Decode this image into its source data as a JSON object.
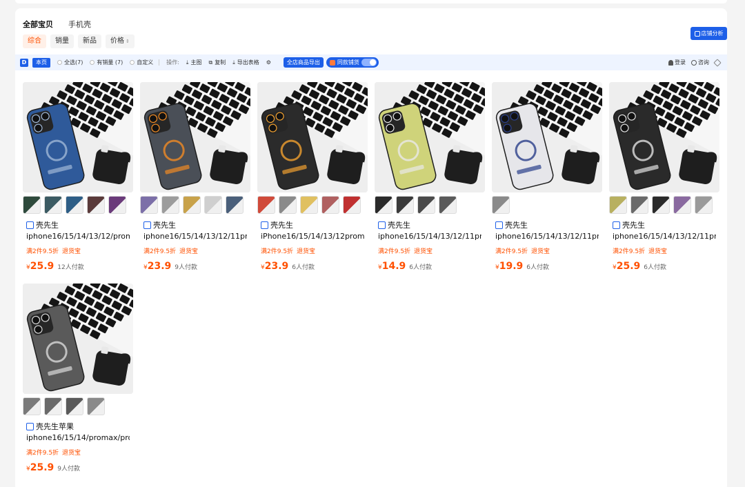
{
  "tabs": [
    {
      "label": "全部宝贝",
      "active": true
    },
    {
      "label": "手机壳",
      "active": false
    }
  ],
  "sorts": [
    {
      "label": "综合",
      "active": true,
      "arrow": ""
    },
    {
      "label": "销量",
      "active": false,
      "arrow": ""
    },
    {
      "label": "新品",
      "active": false,
      "arrow": ""
    },
    {
      "label": "价格",
      "active": false,
      "arrow": "⇕"
    }
  ],
  "shop_analysis_label": "店铺分析",
  "toolbar": {
    "logo": "D",
    "page_label": "本页",
    "select_all": "全选(7)",
    "has_sales": "有销量 (7)",
    "custom": "自定义",
    "ops_label": "操作:",
    "main_image": "主图",
    "copy": "复制",
    "export_table": "导出表格",
    "export_all": "全店商品导出",
    "same_style": "同款铺货",
    "login": "登录",
    "consult": "咨询"
  },
  "colors": {
    "accent": "#1d5fe8",
    "price": "#ff5000",
    "toolbar_bg": "#eef4ff"
  },
  "products": [
    {
      "seller": "壳先生",
      "title": "iphone16/15/14/13/12/promax/pro",
      "promo": "满2件9.5折",
      "guarantee": "退货宝",
      "currency": "¥",
      "price": "25.9",
      "sales": "12人付款",
      "case_color": "#2f5a9a",
      "accent": "#9fb7d6",
      "thumb_colors": [
        "#2e4a3c",
        "#3b5a62",
        "#2e5e86",
        "#5a3a3a",
        "#6a3a7a"
      ]
    },
    {
      "seller": "壳先生",
      "title": "iphone16/15/14/13/12/11pro/promax",
      "promo": "满2件9.5折",
      "guarantee": "退货宝",
      "currency": "¥",
      "price": "23.9",
      "sales": "9人付款",
      "case_color": "#4a4f57",
      "accent": "#f08a24",
      "thumb_colors": [
        "#7c6fa8",
        "#9c9c9c",
        "#c8a24a",
        "#cfcfcf",
        "#4a5f7a"
      ]
    },
    {
      "seller": "壳先生",
      "title": "iPhone16/15/14/13/12promax/pro",
      "promo": "满2件9.5折",
      "guarantee": "退货宝",
      "currency": "¥",
      "price": "23.9",
      "sales": "6人付款",
      "case_color": "#2b2b2b",
      "accent": "#f0a030",
      "thumb_colors": [
        "#d04a3a",
        "#8a8a8a",
        "#e0c060",
        "#b06060",
        "#c03030"
      ]
    },
    {
      "seller": "壳先生",
      "title": "iphone16/15/14/13/12/11pro/promax",
      "promo": "满2件9.5折",
      "guarantee": "退货宝",
      "currency": "¥",
      "price": "14.9",
      "sales": "6人付款",
      "case_color": "#cfd37a",
      "accent": "#e8e8e8",
      "thumb_colors": [
        "#2a2a2a",
        "#3a3a3a",
        "#4a4a4a",
        "#5a5a5a"
      ]
    },
    {
      "seller": "壳先生",
      "title": "iphone16/15/14/13/12/11pro/promax",
      "promo": "满2件9.5折",
      "guarantee": "退货宝",
      "currency": "¥",
      "price": "19.9",
      "sales": "6人付款",
      "case_color": "#e6e6ea",
      "accent": "#2a3f8a",
      "thumb_colors": [
        "#8a8a8a"
      ]
    },
    {
      "seller": "壳先生",
      "title": "iphone16/15/14/13/12/11pro/promax",
      "promo": "满2件9.5折",
      "guarantee": "退货宝",
      "currency": "¥",
      "price": "25.9",
      "sales": "6人付款",
      "case_color": "#2a2a2a",
      "accent": "#e0e0e0",
      "thumb_colors": [
        "#b8b060",
        "#6a6a6a",
        "#2a2a2a",
        "#8a6aa0",
        "#9a9a9a"
      ]
    },
    {
      "seller": "壳先生苹果",
      "title": "iphone16/15/14/promax/pro/plus",
      "promo": "满2件9.5折",
      "guarantee": "退货宝",
      "currency": "¥",
      "price": "25.9",
      "sales": "9人付款",
      "case_color": "#5a5a5a",
      "accent": "#d8d8d8",
      "thumb_colors": [
        "#7a7a7a",
        "#6a6a6a",
        "#5a5a5a",
        "#8a8a8a"
      ]
    }
  ]
}
